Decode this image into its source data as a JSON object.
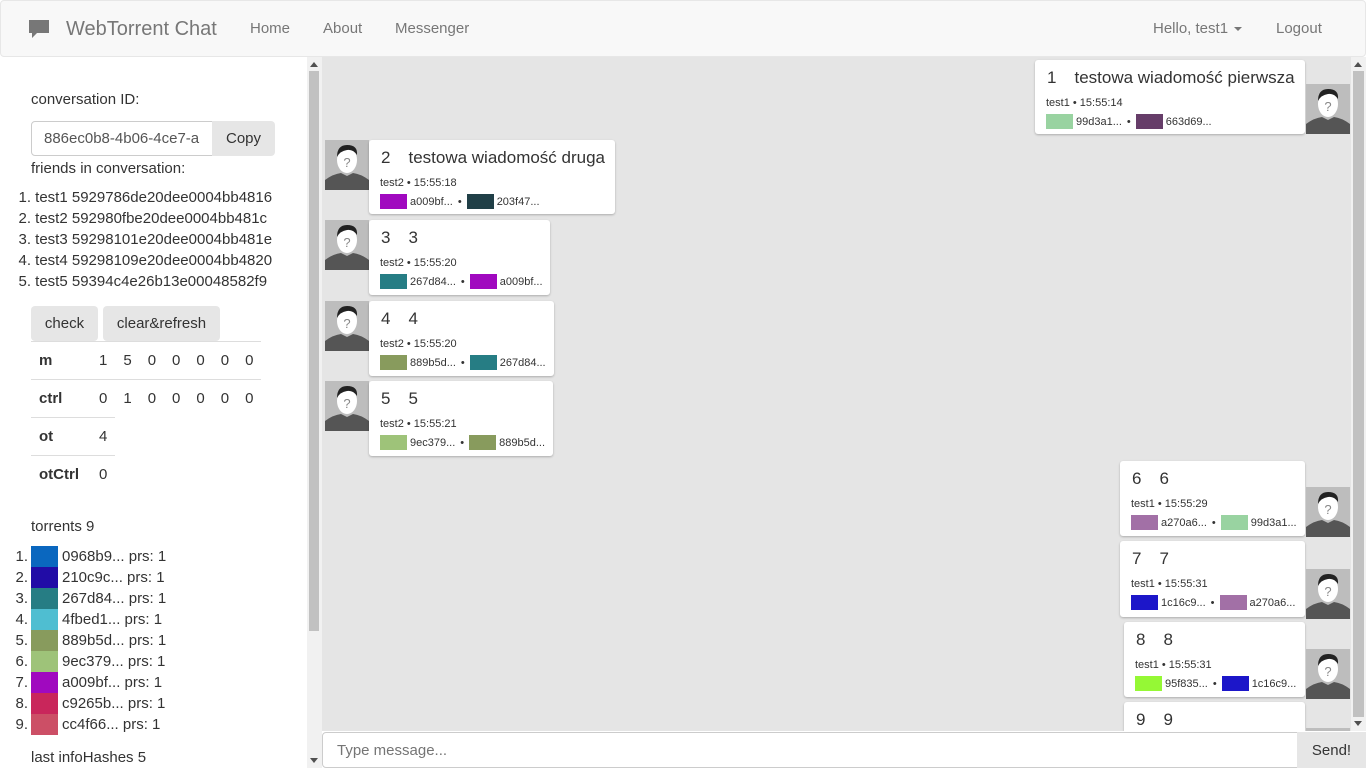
{
  "nav": {
    "brand": "WebTorrent Chat",
    "home": "Home",
    "about": "About",
    "messenger": "Messenger",
    "user": "Hello, test1",
    "logout": "Logout"
  },
  "sidebar": {
    "conv_label": "conversation ID:",
    "conv_value": "886ec0b8-4b06-4ce7-a",
    "copy": "Copy",
    "friends_label": "friends in conversation:",
    "friends": [
      {
        "n": "1.",
        "text": "test1 5929786de20dee0004bb4816"
      },
      {
        "n": "2.",
        "text": "test2 592980fbe20dee0004bb481c"
      },
      {
        "n": "3.",
        "text": "test3 59298101e20dee0004bb481e"
      },
      {
        "n": "4.",
        "text": "test4 59298109e20dee0004bb4820"
      },
      {
        "n": "5.",
        "text": "test5 59394c4e26b13e00048582f9"
      }
    ],
    "check": "check",
    "clear": "clear&refresh",
    "stats": {
      "m": {
        "label": "m",
        "values": [
          "1",
          "5",
          "0",
          "0",
          "0",
          "0",
          "0"
        ]
      },
      "ctrl": {
        "label": "ctrl",
        "values": [
          "0",
          "1",
          "0",
          "0",
          "0",
          "0",
          "0"
        ]
      },
      "ot": {
        "label": "ot",
        "values": [
          "4"
        ]
      },
      "otCtrl": {
        "label": "otCtrl",
        "values": [
          "0"
        ]
      }
    },
    "torrents_label": "torrents 9",
    "torrents": [
      {
        "n": "1.",
        "color": "#0a67bf",
        "text": "0968b9... prs: 1"
      },
      {
        "n": "2.",
        "color": "#210ca6",
        "text": "210c9c... prs: 1"
      },
      {
        "n": "3.",
        "color": "#267d84",
        "text": "267d84... prs: 1"
      },
      {
        "n": "4.",
        "color": "#4fbed1",
        "text": "4fbed1... prs: 1"
      },
      {
        "n": "5.",
        "color": "#889b5d",
        "text": "889b5d... prs: 1"
      },
      {
        "n": "6.",
        "color": "#9ec379",
        "text": "9ec379... prs: 1"
      },
      {
        "n": "7.",
        "color": "#a009bf",
        "text": "a009bf... prs: 1"
      },
      {
        "n": "8.",
        "color": "#c9265b",
        "text": "c9265b... prs: 1"
      },
      {
        "n": "9.",
        "color": "#cc4f66",
        "text": "cc4f66... prs: 1"
      }
    ],
    "last_label": "last infoHashes 5"
  },
  "messages": [
    {
      "n": "1",
      "text": "testowa wiadomość pierwsza",
      "meta": "test1 • 15:55:14",
      "h1": "99d3a1...",
      "c1": "#99d3a1",
      "h2": "663d69...",
      "c2": "#663d69"
    },
    {
      "n": "2",
      "text": "testowa wiadomość druga",
      "meta": "test2 • 15:55:18",
      "h1": "a009bf...",
      "c1": "#a009bf",
      "h2": "203f47...",
      "c2": "#203f47"
    },
    {
      "n": "3",
      "text": "3",
      "meta": "test2 • 15:55:20",
      "h1": "267d84...",
      "c1": "#267d84",
      "h2": "a009bf...",
      "c2": "#a009bf"
    },
    {
      "n": "4",
      "text": "4",
      "meta": "test2 • 15:55:20",
      "h1": "889b5d...",
      "c1": "#889b5d",
      "h2": "267d84...",
      "c2": "#267d84"
    },
    {
      "n": "5",
      "text": "5",
      "meta": "test2 • 15:55:21",
      "h1": "9ec379...",
      "c1": "#9ec379",
      "h2": "889b5d...",
      "c2": "#889b5d"
    },
    {
      "n": "6",
      "text": "6",
      "meta": "test1 • 15:55:29",
      "h1": "a270a6...",
      "c1": "#a270a6",
      "h2": "99d3a1...",
      "c2": "#99d3a1"
    },
    {
      "n": "7",
      "text": "7",
      "meta": "test1 • 15:55:31",
      "h1": "1c16c9...",
      "c1": "#1c16c9",
      "h2": "a270a6...",
      "c2": "#a270a6"
    },
    {
      "n": "8",
      "text": "8",
      "meta": "test1 • 15:55:31",
      "h1": "95f835...",
      "c1": "#95f835",
      "h2": "1c16c9...",
      "c2": "#1c16c9"
    },
    {
      "n": "9",
      "text": "9"
    }
  ],
  "composer": {
    "placeholder": "Type message...",
    "send": "Send!"
  }
}
